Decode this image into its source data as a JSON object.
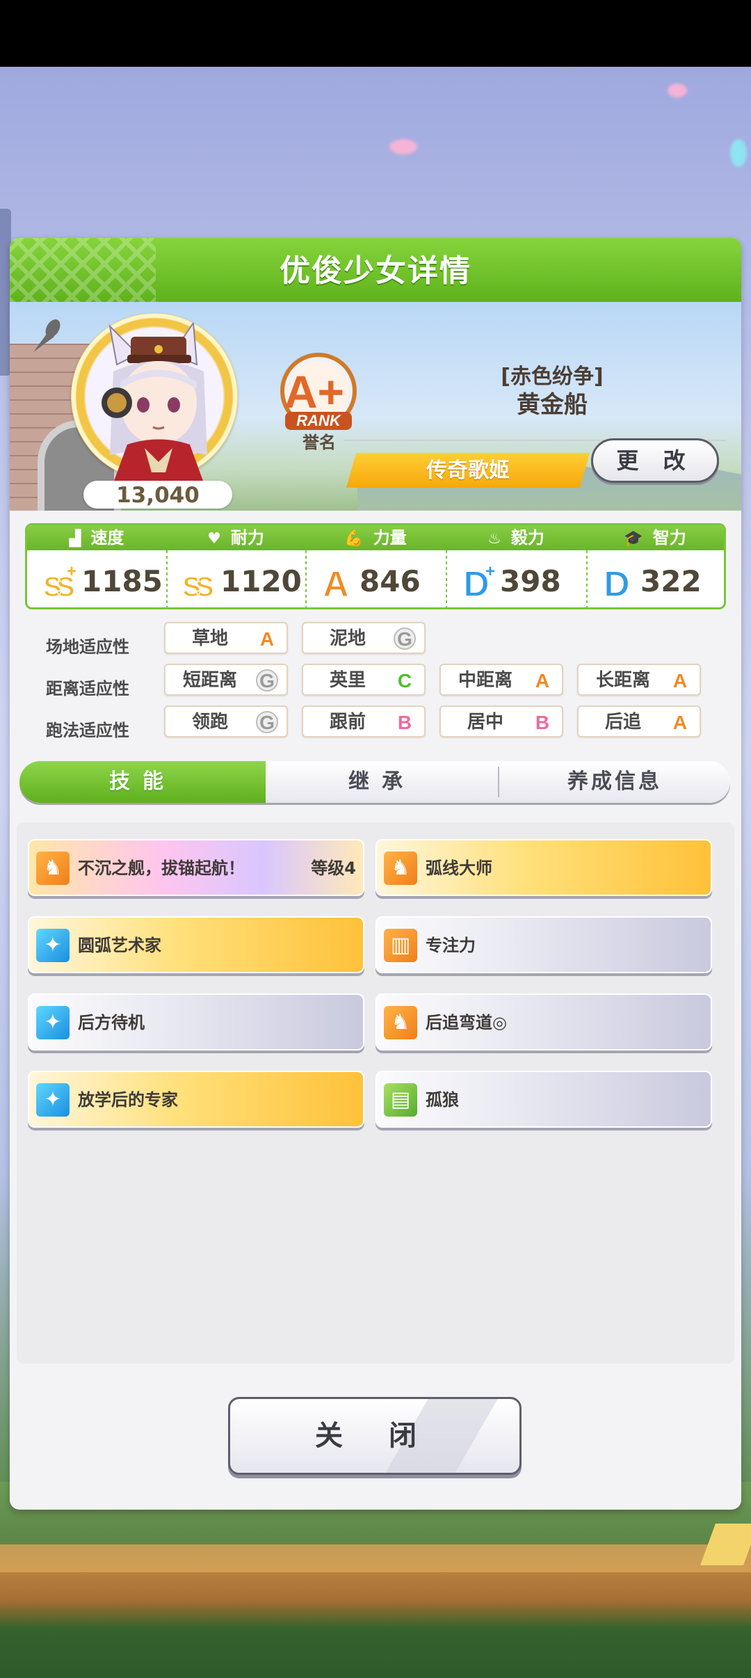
{
  "window": {
    "title": "优俊少女详情"
  },
  "profile": {
    "fans": "13,040",
    "rank": {
      "grade": "A+",
      "text": "RANK",
      "label": "誉名"
    },
    "title_bracket": "[赤色纷争]",
    "name": "黄金船",
    "epithet": "传奇歌姬",
    "change_button": "更 改"
  },
  "stats": [
    {
      "label": "速度",
      "icon": "shoe-icon",
      "grade": "SS+",
      "value": "1185"
    },
    {
      "label": "耐力",
      "icon": "heart-icon",
      "grade": "SS",
      "value": "1120"
    },
    {
      "label": "力量",
      "icon": "muscle-icon",
      "grade": "A",
      "value": "846"
    },
    {
      "label": "毅力",
      "icon": "flame-icon",
      "grade": "D+",
      "value": "398"
    },
    {
      "label": "智力",
      "icon": "graduation-cap-icon",
      "grade": "D",
      "value": "322"
    }
  ],
  "aptitudes": {
    "track": {
      "label": "场地适应性",
      "items": [
        {
          "name": "草地",
          "grade": "A"
        },
        {
          "name": "泥地",
          "grade": "G"
        }
      ]
    },
    "distance": {
      "label": "距离适应性",
      "items": [
        {
          "name": "短距离",
          "grade": "G"
        },
        {
          "name": "英里",
          "grade": "C"
        },
        {
          "name": "中距离",
          "grade": "A"
        },
        {
          "name": "长距离",
          "grade": "A"
        }
      ]
    },
    "strategy": {
      "label": "跑法适应性",
      "items": [
        {
          "name": "领跑",
          "grade": "G"
        },
        {
          "name": "跟前",
          "grade": "B"
        },
        {
          "name": "居中",
          "grade": "B"
        },
        {
          "name": "后追",
          "grade": "A"
        }
      ]
    }
  },
  "tabs": [
    {
      "label": "技能",
      "active": true
    },
    {
      "label": "继承",
      "active": false
    },
    {
      "label": "养成信息",
      "active": false
    }
  ],
  "skills": [
    {
      "name": "不沉之舰，拔锚起航！",
      "level": "等级4",
      "rarity": "unique",
      "icon": "running-horse-icon"
    },
    {
      "name": "弧线大师",
      "rarity": "gold",
      "icon": "running-horse-icon"
    },
    {
      "name": "圆弧艺术家",
      "rarity": "gold",
      "icon": "sparkle-icon"
    },
    {
      "name": "专注力",
      "rarity": "plain",
      "icon": "starting-gate-icon"
    },
    {
      "name": "后方待机",
      "rarity": "plain",
      "icon": "sparkle-icon"
    },
    {
      "name": "后追弯道◎",
      "rarity": "plain",
      "icon": "running-horse-icon"
    },
    {
      "name": "放学后的专家",
      "rarity": "gold",
      "icon": "sparkle-icon"
    },
    {
      "name": "孤狼",
      "rarity": "plain",
      "icon": "card-icon"
    }
  ],
  "close_button": "关 闭",
  "colors": {
    "header_green": "#6ab529",
    "gold": "#ffc13a",
    "grade_A": "#f08a24",
    "grade_G": "#9a9a9a",
    "grade_C": "#4fbf2a",
    "grade_B": "#f06aa0",
    "grade_D": "#2f9be6"
  }
}
